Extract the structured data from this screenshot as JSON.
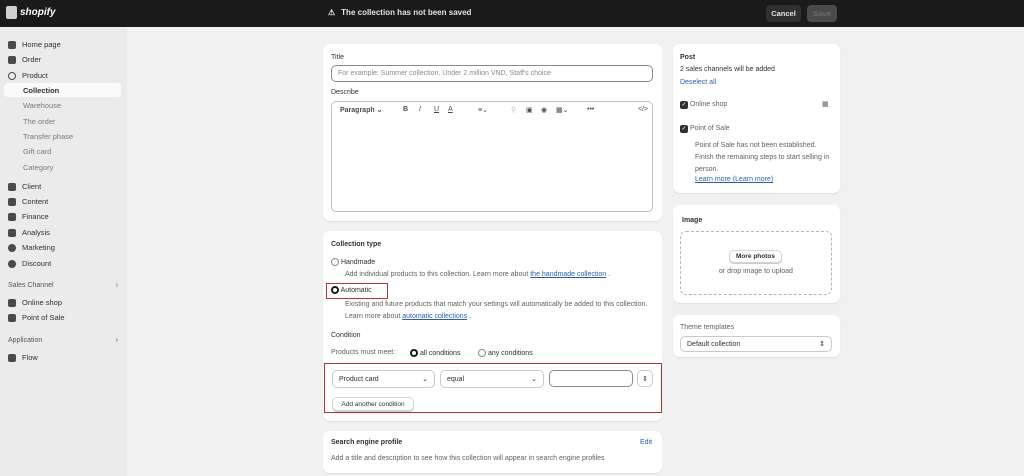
{
  "topbar": {
    "brand": "shopify",
    "warning": "The collection has not been saved",
    "cancel": "Cancel",
    "save": "Save"
  },
  "sidebar": {
    "items": [
      "Home page",
      "Order",
      "Product"
    ],
    "product_sub": [
      "Collection",
      "Warehouse",
      "The order",
      "Transfer phase",
      "Gift card",
      "Category"
    ],
    "items2": [
      "Client",
      "Content",
      "Finance",
      "Analysis",
      "Marketing",
      "Discount"
    ],
    "sales_channel": "Sales Channel",
    "channels": [
      "Online shop",
      "Point of Sale"
    ],
    "application": "Application",
    "apps": [
      "Flow"
    ]
  },
  "title_card": {
    "title_label": "Title",
    "title_placeholder": "For example: Summer collection, Under 2 million VND, Staff's choice",
    "describe_label": "Describe",
    "toolbar": {
      "paragraph": "Paragraph",
      "bold": "B",
      "italic": "I",
      "underline": "U",
      "color": "A",
      "more": "•••",
      "code": "</>"
    }
  },
  "collection_type": {
    "heading": "Collection type",
    "handmade": "Handmade",
    "handmade_desc": "Add individual products to this collection. Learn more about",
    "handmade_link": "the handmade collection",
    "automatic": "Automatic",
    "automatic_desc": "Existing and future products that match your settings will automatically be added to this collection. Learn more about",
    "automatic_link": "automatic collections",
    "condition": "Condition",
    "must_meet": "Products must meet:",
    "all": "all conditions",
    "any": "any conditions",
    "field": "Product card",
    "operator": "equal",
    "value": "",
    "add": "Add another condition"
  },
  "seo": {
    "heading": "Search engine profile",
    "edit": "Edit",
    "desc": "Add a title and description to see how this collection will appear in search engine profiles"
  },
  "post": {
    "heading": "Post",
    "sub": "2 sales channels will be added",
    "deselect": "Deselect all",
    "online": "Online shop",
    "pos": "Point of Sale",
    "pos_desc": "Point of Sale has not been established. Finish the remaining steps to start selling in person.",
    "learn": "Learn more (Learn more)"
  },
  "image": {
    "heading": "Image",
    "button": "More photos",
    "hint": "or drop image to upload"
  },
  "theme": {
    "heading": "Theme templates",
    "value": "Default collection"
  }
}
